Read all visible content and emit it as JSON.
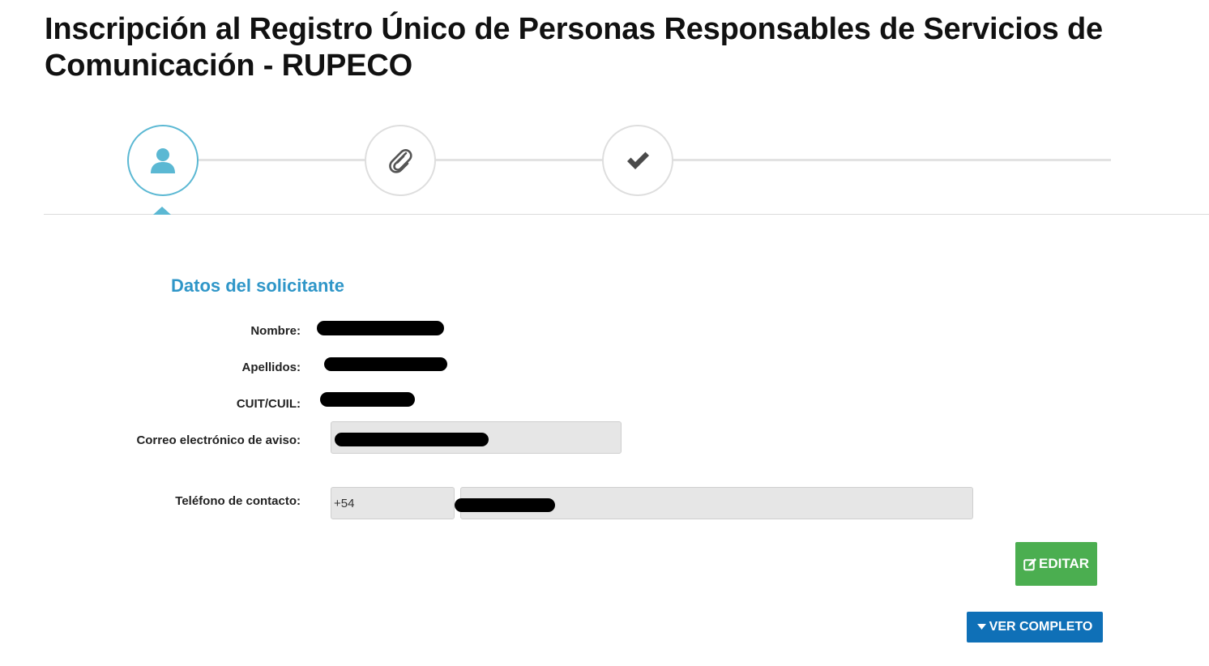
{
  "page": {
    "title": "Inscripción al Registro Único de Personas Responsables de Servicios de Comunicación - RUPECO"
  },
  "stepper": {
    "steps": [
      {
        "icon": "user-icon",
        "state": "active"
      },
      {
        "icon": "paperclip-icon",
        "state": "pending"
      },
      {
        "icon": "check-icon",
        "state": "pending"
      }
    ],
    "active_color": "#5bb8d3"
  },
  "section": {
    "title": "Datos del solicitante"
  },
  "fields": {
    "nombre_label": "Nombre:",
    "apellidos_label": "Apellidos:",
    "cuit_label": "CUIT/CUIL:",
    "correo_label": "Correo electrónico de aviso:",
    "telefono_label": "Teléfono de contacto:",
    "telefono_prefix": "+54"
  },
  "buttons": {
    "edit_label": "EDITAR",
    "edit_color": "#4bae50",
    "full_label": "VER COMPLETO",
    "full_color": "#0f70b7"
  }
}
